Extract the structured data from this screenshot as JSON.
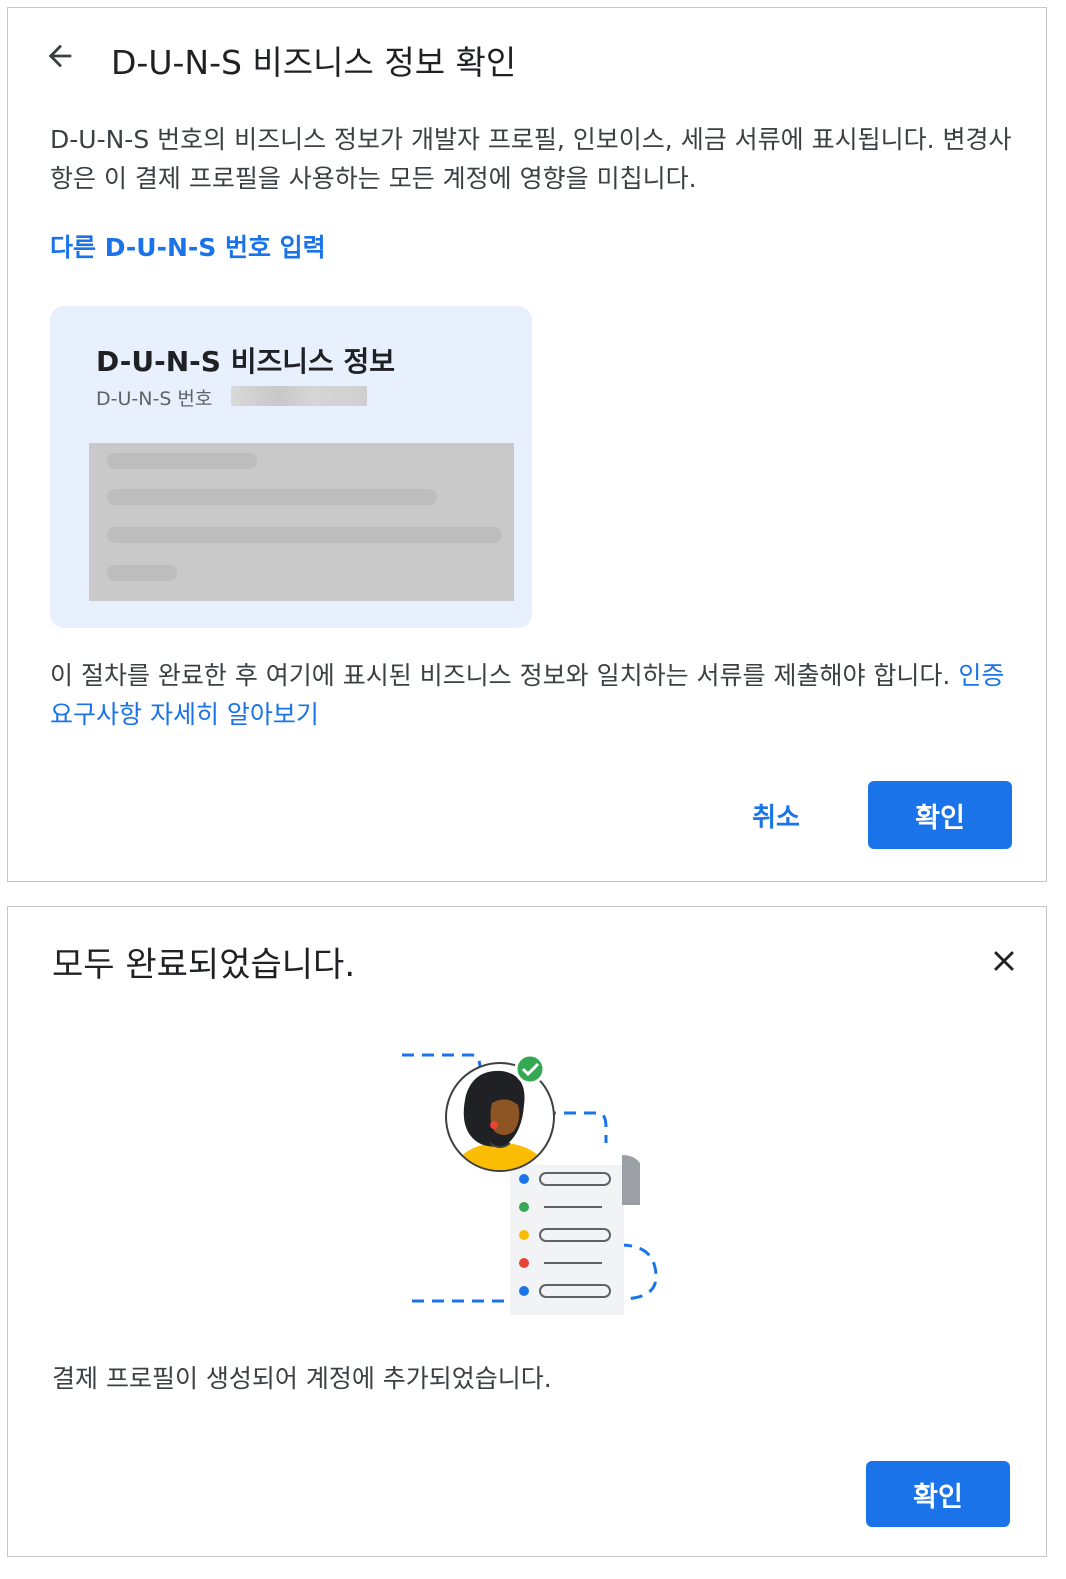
{
  "verify_dialog": {
    "title": "D-U-N-S 비즈니스 정보 확인",
    "description": "D-U-N-S 번호의 비즈니스 정보가 개발자 프로필, 인보이스, 세금 서류에 표시됩니다. 변경사항은 이 결제 프로필을 사용하는 모든 계정에 영향을 미칩니다.",
    "enter_other_link": "다른 D-U-N-S 번호 입력",
    "card": {
      "title": "D-U-N-S 비즈니스 정보",
      "number_label": "D-U-N-S 번호"
    },
    "note_text": "이 절차를 완료한 후 여기에 표시된 비즈니스 정보와 일치하는 서류를 제출해야 합니다. ",
    "note_link": "인증 요구사항 자세히 알아보기",
    "cancel_label": "취소",
    "confirm_label": "확인",
    "icons": {
      "back": "arrow-back-icon"
    },
    "colors": {
      "accent": "#1a73e8",
      "card_bg": "#e8f0fe"
    }
  },
  "done_dialog": {
    "title": "모두 완료되었습니다.",
    "message": "결제 프로필이 생성되어 계정에 추가되었습니다.",
    "confirm_label": "확인",
    "icons": {
      "close": "close-icon",
      "illustration": "profile-checklist-illustration"
    },
    "checklist_dot_colors": [
      "#1a73e8",
      "#34a853",
      "#fbbc04",
      "#ea4335",
      "#1a73e8"
    ]
  }
}
